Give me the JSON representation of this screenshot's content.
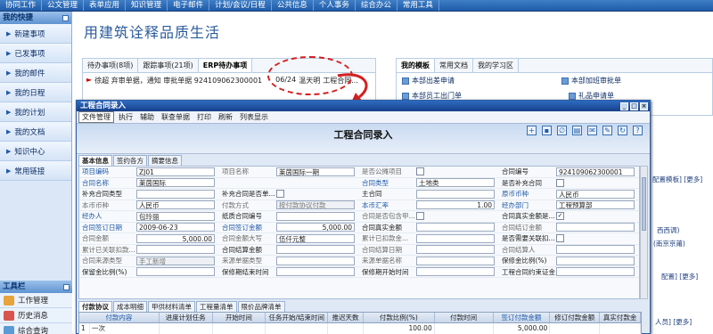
{
  "top_nav": [
    "协同工作",
    "公文管理",
    "表单应用",
    "知识管理",
    "电子邮件",
    "计划/会议/日程",
    "公共信息",
    "个人事务",
    "综合办公",
    "常用工具"
  ],
  "sidebar": {
    "header": "我的快捷",
    "items": [
      "新建事项",
      "已发事项",
      "我的邮件",
      "我的日程",
      "我的计划",
      "我的文档",
      "知识中心",
      "常用链接"
    ],
    "tools_header": "工具栏",
    "tools": [
      "工作管理",
      "历史消息",
      "综合查询"
    ]
  },
  "page_title": "用建筑诠释品质生活",
  "task_tabs": [
    "待办事项(8项)",
    "跟踪事项(21项)",
    "ERP待办事项"
  ],
  "task_row": {
    "title": "徐超 弃审单据，通知 审批单据 924109062300001",
    "date": "06/24",
    "person": "温天明",
    "type": "工程合同..."
  },
  "right_tabs": [
    "我的模板",
    "常用文档",
    "我的学习区"
  ],
  "templates": [
    "本部出差申请",
    "本部加班审批单",
    "本部员工出门单",
    "礼品申请单"
  ],
  "right_snippets": {
    "more_template": "配置模板] [更多]",
    "xixi": "西西调)",
    "nanjing": "(南京京莆)",
    "more2": "配置] [更多]",
    "more3": "人员] [更多]"
  },
  "dialog": {
    "title": "工程合同录入",
    "menu": [
      "文件管理",
      "执行",
      "辅助",
      "联查单据",
      "打印",
      "刷新",
      "列表显示"
    ],
    "form_title": "工程合同录入",
    "toolbar_icons": [
      "new-icon",
      "save-icon",
      "attach-icon",
      "print-icon",
      "email-icon",
      "edit-icon",
      "refresh-icon",
      "help-icon"
    ],
    "subtabs": [
      "基本信息",
      "签约各方",
      "摘要信息"
    ],
    "rows": [
      [
        {
          "l": "项目编码",
          "v": "ZJ01",
          "c": "blue"
        },
        {
          "l": "项目名称",
          "v": "莱茵国际一期",
          "c": "gray"
        },
        {
          "l": "是否公摊项目",
          "ck": "",
          "c": "gray"
        },
        {
          "l": "合同编号",
          "v": "924109062300001",
          "c": ""
        }
      ],
      [
        {
          "l": "合同名称",
          "v": "莱茵国际",
          "c": "blue"
        },
        {
          "l": "",
          "v": "",
          "c": ""
        },
        {
          "l": "合同类型",
          "v": "土地类",
          "c": "blue"
        },
        {
          "l": "是否补充合同",
          "ck": "",
          "c": ""
        }
      ],
      [
        {
          "l": "补充合同类型",
          "v": "",
          "c": ""
        },
        {
          "l": "补充合同是否单...",
          "ck": "",
          "c": ""
        },
        {
          "l": "主合同",
          "v": "",
          "c": ""
        },
        {
          "l": "原币币种",
          "v": "人民币",
          "c": "blue"
        }
      ],
      [
        {
          "l": "本币币种",
          "v": "人民币",
          "c": "gray"
        },
        {
          "l": "付款方式",
          "v": "按付款协议付款",
          "c": "gray",
          "d": true
        },
        {
          "l": "本币汇率",
          "v": "1.00",
          "c": "blue",
          "n": true
        },
        {
          "l": "经办部门",
          "v": "工程预算部",
          "c": "blue"
        }
      ],
      [
        {
          "l": "经办人",
          "v": "包玲丽",
          "c": "blue"
        },
        {
          "l": "纸质合同编号",
          "v": "",
          "c": ""
        },
        {
          "l": "合同是否包含甲...",
          "ck": "",
          "c": "gray"
        },
        {
          "l": "合同真实金额是...",
          "ck": "✓",
          "c": ""
        }
      ],
      [
        {
          "l": "合同签订日期",
          "v": "2009-06-23",
          "c": "blue"
        },
        {
          "l": "合同签订金额",
          "v": "5,000.00",
          "c": "blue",
          "n": true
        },
        {
          "l": "合同真实金额",
          "v": "",
          "c": ""
        },
        {
          "l": "合同结订金额",
          "v": "",
          "c": "gray"
        }
      ],
      [
        {
          "l": "合同金额",
          "v": "5,000.00",
          "c": "gray",
          "n": true
        },
        {
          "l": "合同金额大写",
          "v": "伍仟元整",
          "c": "gray"
        },
        {
          "l": "累计已扣款金...",
          "v": "",
          "c": "gray"
        },
        {
          "l": "是否需要关联扣...",
          "ck": "",
          "c": ""
        }
      ],
      [
        {
          "l": "累计已关联扣款...",
          "v": "",
          "c": "gray"
        },
        {
          "l": "合同结算金额",
          "v": "",
          "c": ""
        },
        {
          "l": "合同结算日期",
          "v": "",
          "c": "gray"
        },
        {
          "l": "合同结算人",
          "v": "",
          "c": "gray"
        }
      ],
      [
        {
          "l": "合同来源类型",
          "v": "手工新增",
          "c": "gray",
          "d": true
        },
        {
          "l": "来源单据类型",
          "v": "",
          "c": "gray"
        },
        {
          "l": "来源单据名称",
          "v": "",
          "c": "gray"
        },
        {
          "l": "保修金比例(%)",
          "v": "",
          "c": ""
        }
      ],
      [
        {
          "l": "保留金比例(%)",
          "v": "",
          "c": ""
        },
        {
          "l": "保修期结束时间",
          "v": "",
          "c": ""
        },
        {
          "l": "保修期开始时间",
          "v": "",
          "c": ""
        },
        {
          "l": "工程合同约束证金...",
          "v": "",
          "c": ""
        }
      ]
    ],
    "bottom_tabs": [
      "付款协议",
      "成本明细",
      "甲供材料清单",
      "工程量清单",
      "限价品牌清单"
    ],
    "grid_headers": [
      "付款内容",
      "进度计划任务",
      "开始时间",
      "任务开始/结束时间",
      "推迟天数",
      "付款比例(%)",
      "付款时间",
      "签订付款金额",
      "修订付款金额",
      "真实付款金"
    ],
    "grid_rows": [
      [
        "1",
        "一次",
        "",
        "",
        "",
        "",
        "100.00",
        "",
        "5,000.00",
        "",
        ""
      ]
    ]
  }
}
